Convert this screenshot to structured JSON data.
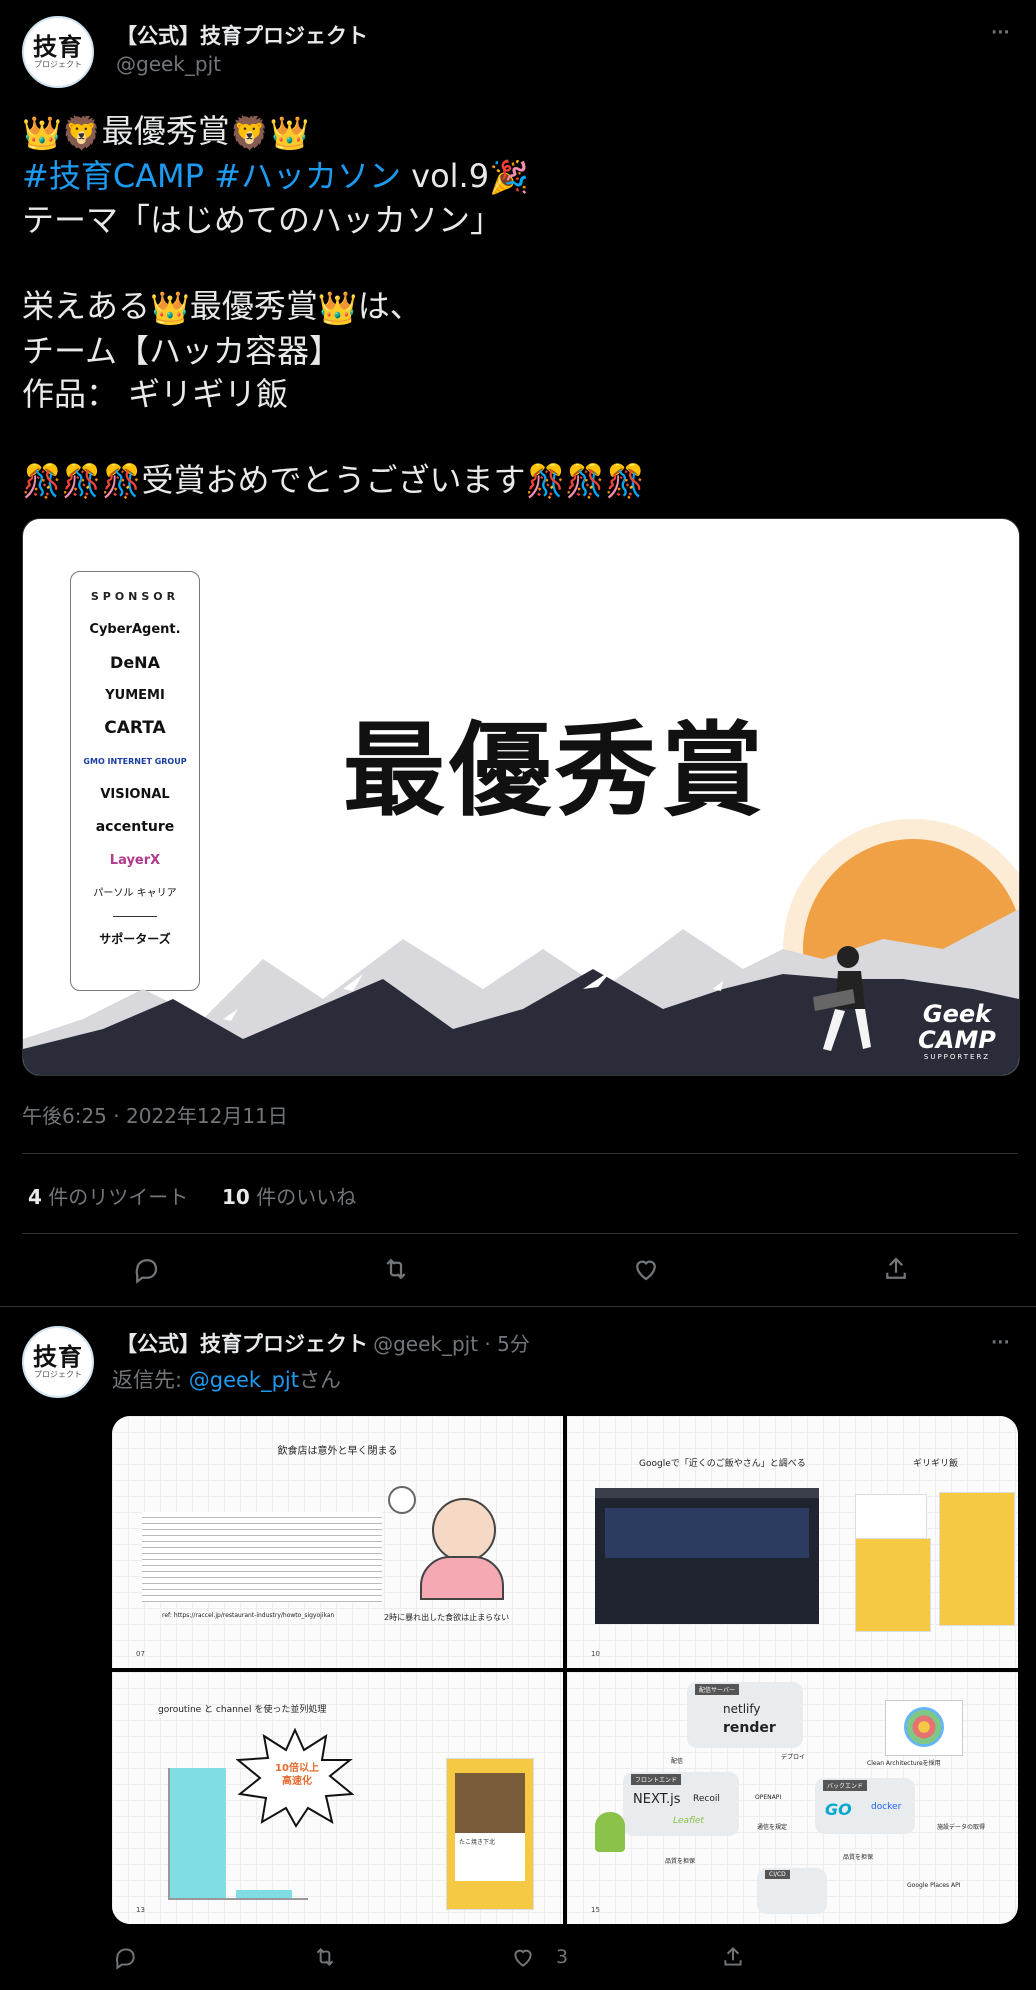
{
  "tweet": {
    "author_name": "【公式】技育プロジェクト",
    "author_handle": "@geek_pjt",
    "avatar_text": "技育",
    "avatar_sub": "プロジェクト",
    "line1_text": "最優秀賞",
    "hashtag1": "#技育CAMP",
    "hashtag2": "#ハッカソン",
    "line2_suffix": " vol.9",
    "line3": "テーマ「はじめてのハッカソン」",
    "line4_prefix": "栄えある",
    "line4_mid": "最優秀賞",
    "line4_suffix": "は、",
    "line5": "チーム【ハッカ容器】",
    "line6": "作品： ギリギリ飯",
    "line7": "受賞おめでとうございます",
    "timestamp": "午後6:25 · 2022年12月11日",
    "retweets_count": "4",
    "retweets_label": " 件のリツイート",
    "likes_count": "10",
    "likes_label": " 件のいいね"
  },
  "image": {
    "sponsor_title": "SPONSOR",
    "sponsors": [
      "CyberAgent.",
      "DeNA",
      "YUMEMI",
      "CARTA",
      "GMO INTERNET GROUP",
      "VISIONAL",
      "accenture",
      "LayerX",
      "パーソル キャリア",
      "サポーターズ"
    ],
    "award_text": "最優秀賞",
    "logo_text": "Geek CAMP",
    "logo_sub": "SUPPORTERZ"
  },
  "reply": {
    "author_name": "【公式】技育プロジェクト",
    "author_handle": "@geek_pjt",
    "time": " · 5分",
    "reply_to_label": "返信先: ",
    "reply_to_handle": "@geek_pjt",
    "reply_to_suffix": "さん",
    "like_count": "3",
    "slides": {
      "s1_title": "飲食店は意外と早く閉まる",
      "s1_ref": "ref: https://raccel.jp/restaurant-industry/howto_sigyojikan",
      "s1_caption": "2時に暴れ出した食欲は止まらない",
      "s1_page": "07",
      "s2_title": "Googleで「近くのご飯やさん」と調べる",
      "s2_title_b": "ギリギリ飯",
      "s2_page": "10",
      "s3_title": "goroutine と channel を使った並列処理",
      "s3_badge1": "10倍以上",
      "s3_badge2": "高速化",
      "s3_page": "13",
      "s3_app_label": "たこ焼き下北",
      "s4_labels": [
        "配信サーバー",
        "netlify",
        "render",
        "フロントエンド",
        "NEXT.js",
        "Recoil",
        "Leaflet",
        "OPENAPI",
        "通信を規定",
        "バックエンド",
        "GO",
        "docker",
        "CI/CD",
        "Clean Architectureを採用",
        "施設データの取得",
        "Google Places API",
        "配信",
        "デプロイ",
        "品質を担保",
        "品質を担保"
      ],
      "s4_page": "15"
    }
  },
  "colors": {
    "accent": "#1d9bf0",
    "bg": "#000000",
    "muted": "#71767b",
    "divider": "#2f3336",
    "sun": "#f0a146",
    "mountain": "#2b2c3a"
  }
}
